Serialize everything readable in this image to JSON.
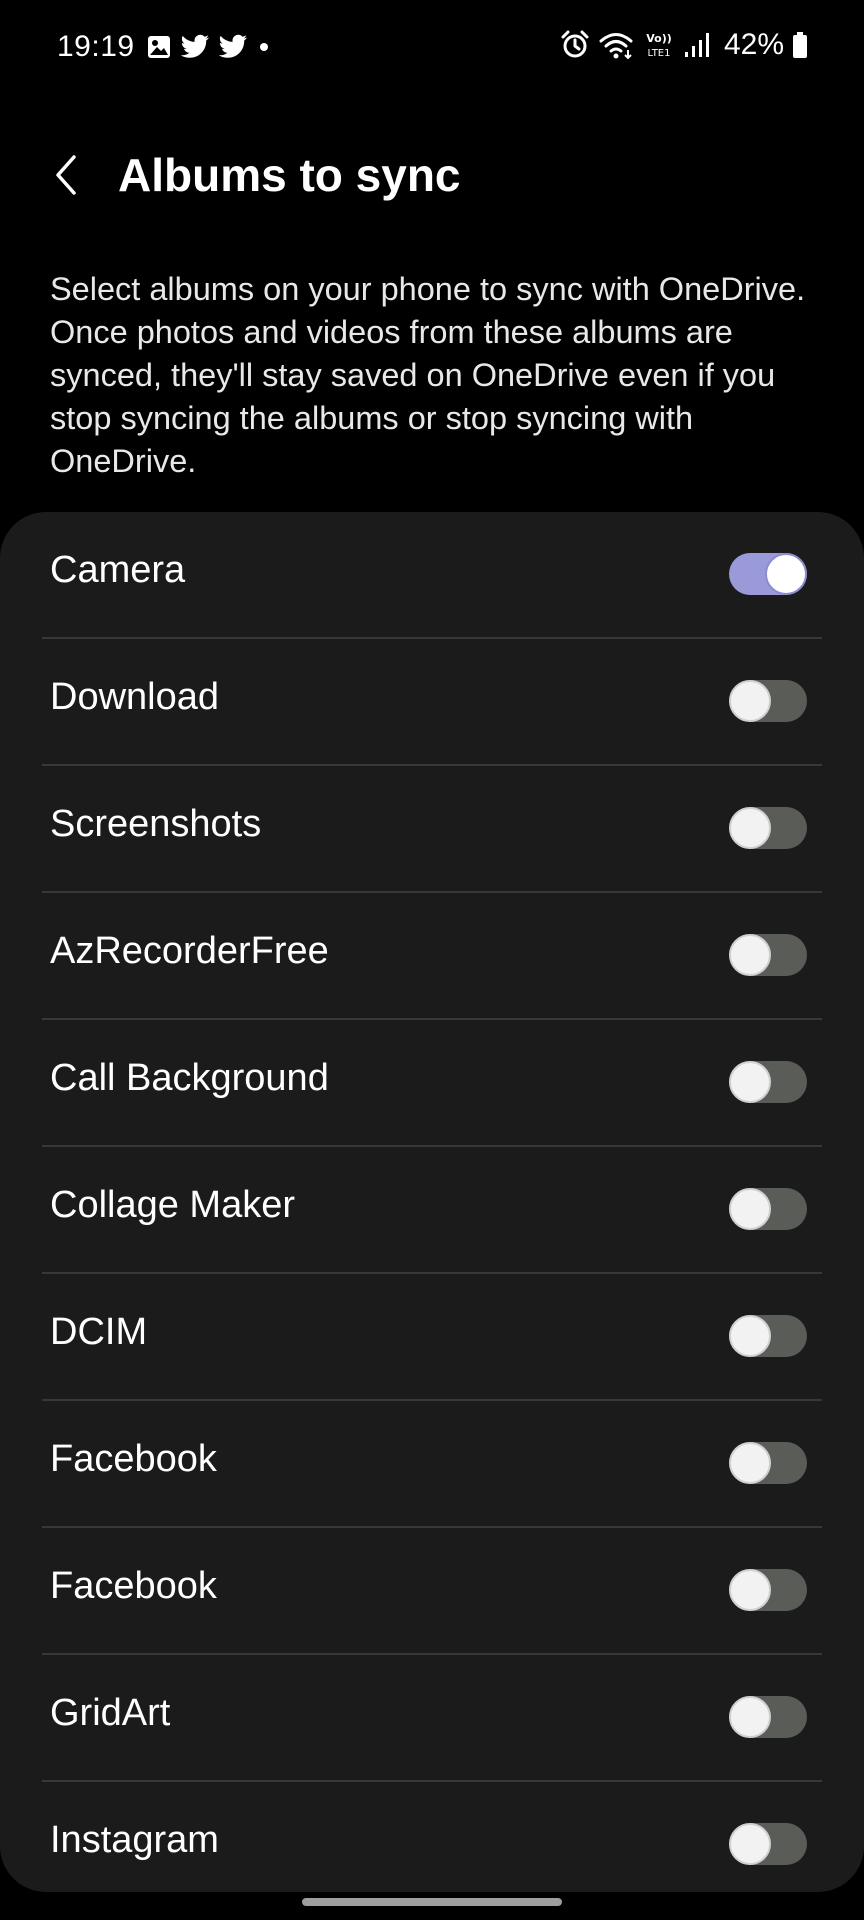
{
  "status_bar": {
    "time": "19:19",
    "battery": "42%",
    "network_label": "VoLTE1",
    "left_icons": [
      "gallery-icon",
      "twitter-icon",
      "twitter-icon",
      "dot-icon"
    ],
    "right_icons": [
      "alarm-icon",
      "wifi-icon",
      "volte-icon",
      "signal-icon",
      "battery-icon"
    ]
  },
  "header": {
    "title": "Albums to sync",
    "back_icon": "chevron-left-icon"
  },
  "description": "Select albums on your phone to sync with OneDrive. Once photos and videos from these albums are synced, they'll stay saved on OneDrive even if you stop syncing the albums or stop syncing with OneDrive.",
  "albums": [
    {
      "label": "Camera",
      "enabled": true
    },
    {
      "label": "Download",
      "enabled": false
    },
    {
      "label": "Screenshots",
      "enabled": false
    },
    {
      "label": "AzRecorderFree",
      "enabled": false
    },
    {
      "label": "Call Background",
      "enabled": false
    },
    {
      "label": "Collage Maker",
      "enabled": false
    },
    {
      "label": "DCIM",
      "enabled": false
    },
    {
      "label": "Facebook",
      "enabled": false
    },
    {
      "label": "Facebook",
      "enabled": false
    },
    {
      "label": "GridArt",
      "enabled": false
    },
    {
      "label": "Instagram",
      "enabled": false
    }
  ],
  "colors": {
    "background": "#000000",
    "card": "#1b1b1b",
    "toggle_on": "#9a9ad8",
    "toggle_off": "#5a5c58",
    "divider": "#383838"
  }
}
